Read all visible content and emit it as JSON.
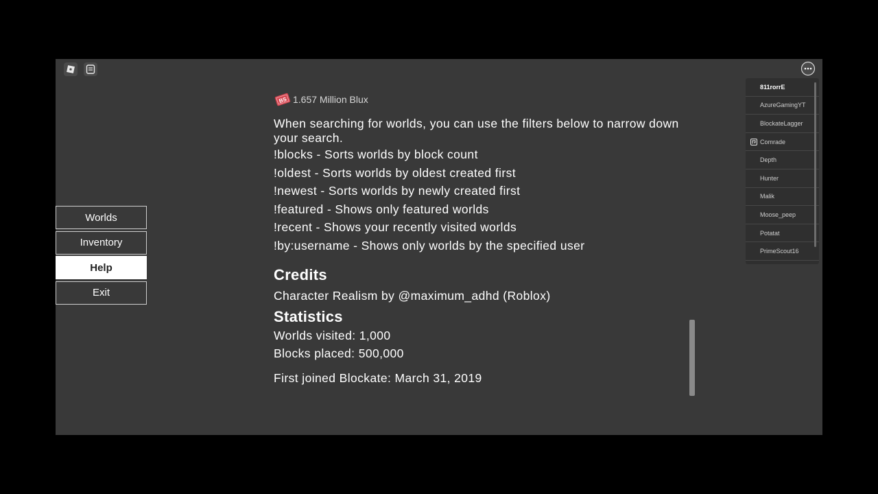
{
  "currency": {
    "label": "1.657 Million Blux",
    "icon": "bs-coin-icon",
    "icon_text": "BS"
  },
  "menu": [
    {
      "label": "Worlds",
      "active": false
    },
    {
      "label": "Inventory",
      "active": false
    },
    {
      "label": "Help",
      "active": true
    },
    {
      "label": "Exit",
      "active": false
    }
  ],
  "help": {
    "intro": "When searching for worlds, you can use the filters below to narrow down your search.",
    "filters": [
      "!blocks - Sorts worlds by block count",
      "!oldest - Sorts worlds by oldest created first",
      "!newest - Sorts worlds by newly created first",
      "!featured - Shows only featured worlds",
      "!recent - Shows your recently visited worlds",
      "!by:username - Shows only worlds by the specified user"
    ]
  },
  "credits": {
    "heading": "Credits",
    "line": "Character Realism by @maximum_adhd (Roblox)"
  },
  "statistics": {
    "heading": "Statistics",
    "worlds_visited": "Worlds visited: 1,000",
    "blocks_placed": "Blocks placed: 500,000",
    "first_joined": "First joined Blockate: March 31, 2019"
  },
  "players": [
    {
      "name": "811rorrE",
      "me": true
    },
    {
      "name": "AzureGamingYT"
    },
    {
      "name": "BlockateLagger"
    },
    {
      "name": "Comrade",
      "badge": true
    },
    {
      "name": "Depth"
    },
    {
      "name": "Hunter"
    },
    {
      "name": "Malik"
    },
    {
      "name": "Moose_peep"
    },
    {
      "name": "Potatat"
    },
    {
      "name": "PrimeScout16"
    }
  ],
  "colors": {
    "background": "#393939",
    "accent_coin": "#d64550",
    "active_button": "#ffffff"
  }
}
